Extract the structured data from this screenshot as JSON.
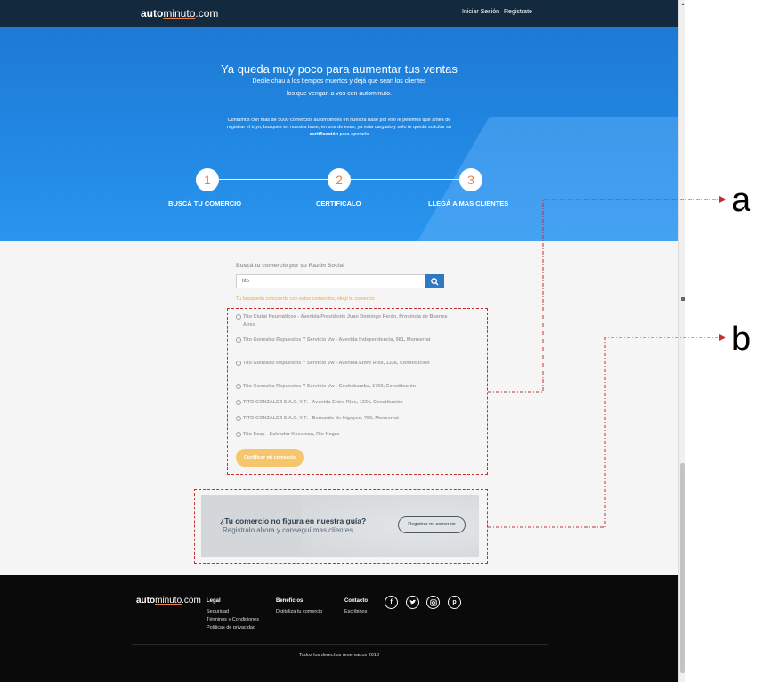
{
  "header": {
    "logo": {
      "bold": "auto",
      "regular": "minuto",
      "suffix": ".com"
    },
    "nav": {
      "login": "Iniciar Sesión",
      "register": "Registrate"
    }
  },
  "hero": {
    "title": "Ya queda muy poco para aumentar tus ventas",
    "subtitle_line1": "Decile chau a los tiempos muertos y dejá que sean los clientes",
    "subtitle_line2": "los que vengan a vos con autominuto.",
    "body_part1": "Contamos con mas de 5000 comercios automotrices en nuestra base por eso le pedimos que antes de registrar el tuyo, busques en nuestra base, en una de esas, ya esta cargado y solo te queda solicitar su ",
    "body_bold": "certificación",
    "body_part2": " para operarlo",
    "steps": [
      {
        "number": "1",
        "label": "BUSCÁ TU COMERCIO"
      },
      {
        "number": "2",
        "label": "CERTIFICALO"
      },
      {
        "number": "3",
        "label": "LLEGÁ A MAS CLIENTES"
      }
    ]
  },
  "search": {
    "label": "Buscá tu comercio por su Razón Social",
    "value": "tito",
    "results_note": "Tu búsqueda concuerda con estos comercios, elegí tu comercio",
    "results": [
      "Tito Ciutat Neumáticos - Avenida Presidente Juan Domingo Perón, Provincia de Buenos Aires",
      "Tito Gonzalez Repuestos Y Servicio Vw - Avenida Independencia, 981, Monserrat",
      "Tito Gonzalez Repuestos Y Servicio Vw - Avenida Entre Rios, 1336, Constitución",
      "Tito Gonzalez Repuestos Y Servicio Vw - Cochabamba, 1760, Constitución",
      "TITO GONZALEZ S.A.C. Y F. - Avenida Entre Rios, 1334, Constitución",
      "TITO GONZALEZ S.A.C. Y F. - Bernardo de Irigoyen, 780, Monserrat",
      "Tito Scap - Salvador Kossman, Rio Negro"
    ],
    "certify_button": "Certificar mi comercio"
  },
  "register_banner": {
    "question": "¿Tu comercio no figura en nuestra guía?",
    "subtitle": "Registralo ahora y conseguí mas clientes",
    "button": "Registrar mi comercio"
  },
  "annotations": {
    "a": "a",
    "b": "b",
    "color": "#c43030"
  },
  "footer": {
    "logo": {
      "bold": "auto",
      "regular": "minuto",
      "suffix": ".com"
    },
    "columns": [
      {
        "title": "Legal",
        "links": [
          "Seguridad",
          "Términos y Condiciones",
          "Políticas de privacidad"
        ]
      },
      {
        "title": "Beneficios",
        "links": [
          "Digitaliza tu comercio"
        ]
      },
      {
        "title": "Contacto",
        "links": [
          "Escribinos"
        ]
      }
    ],
    "social_icons": [
      "facebook-icon",
      "twitter-icon",
      "instagram-icon",
      "pinterest-icon"
    ],
    "copyright": "Todos los derechos reservados 2018"
  },
  "colors": {
    "header_bg": "#13293d",
    "hero_blue": "#2188e3",
    "accent_orange": "#e8824a",
    "search_button": "#2f78c4",
    "certify_button": "#f7c56c",
    "footer_bg": "#0a0a0a"
  }
}
